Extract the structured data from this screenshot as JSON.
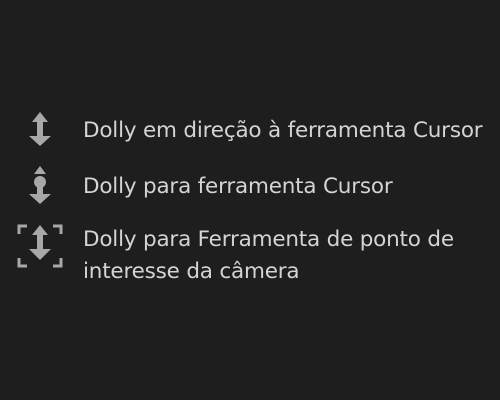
{
  "menu": {
    "items": [
      {
        "icon": "dolly-arrow-icon",
        "label": "Dolly em direção à ferramenta Cursor"
      },
      {
        "icon": "dolly-to-cursor-icon",
        "label": "Dolly para ferramenta Cursor"
      },
      {
        "icon": "dolly-to-poi-icon",
        "label": "Dolly para Ferramenta de ponto de interesse da câmera"
      }
    ]
  },
  "colors": {
    "background": "#1e1e1e",
    "text": "#d4d4d4",
    "icon": "#a8a8a8"
  }
}
